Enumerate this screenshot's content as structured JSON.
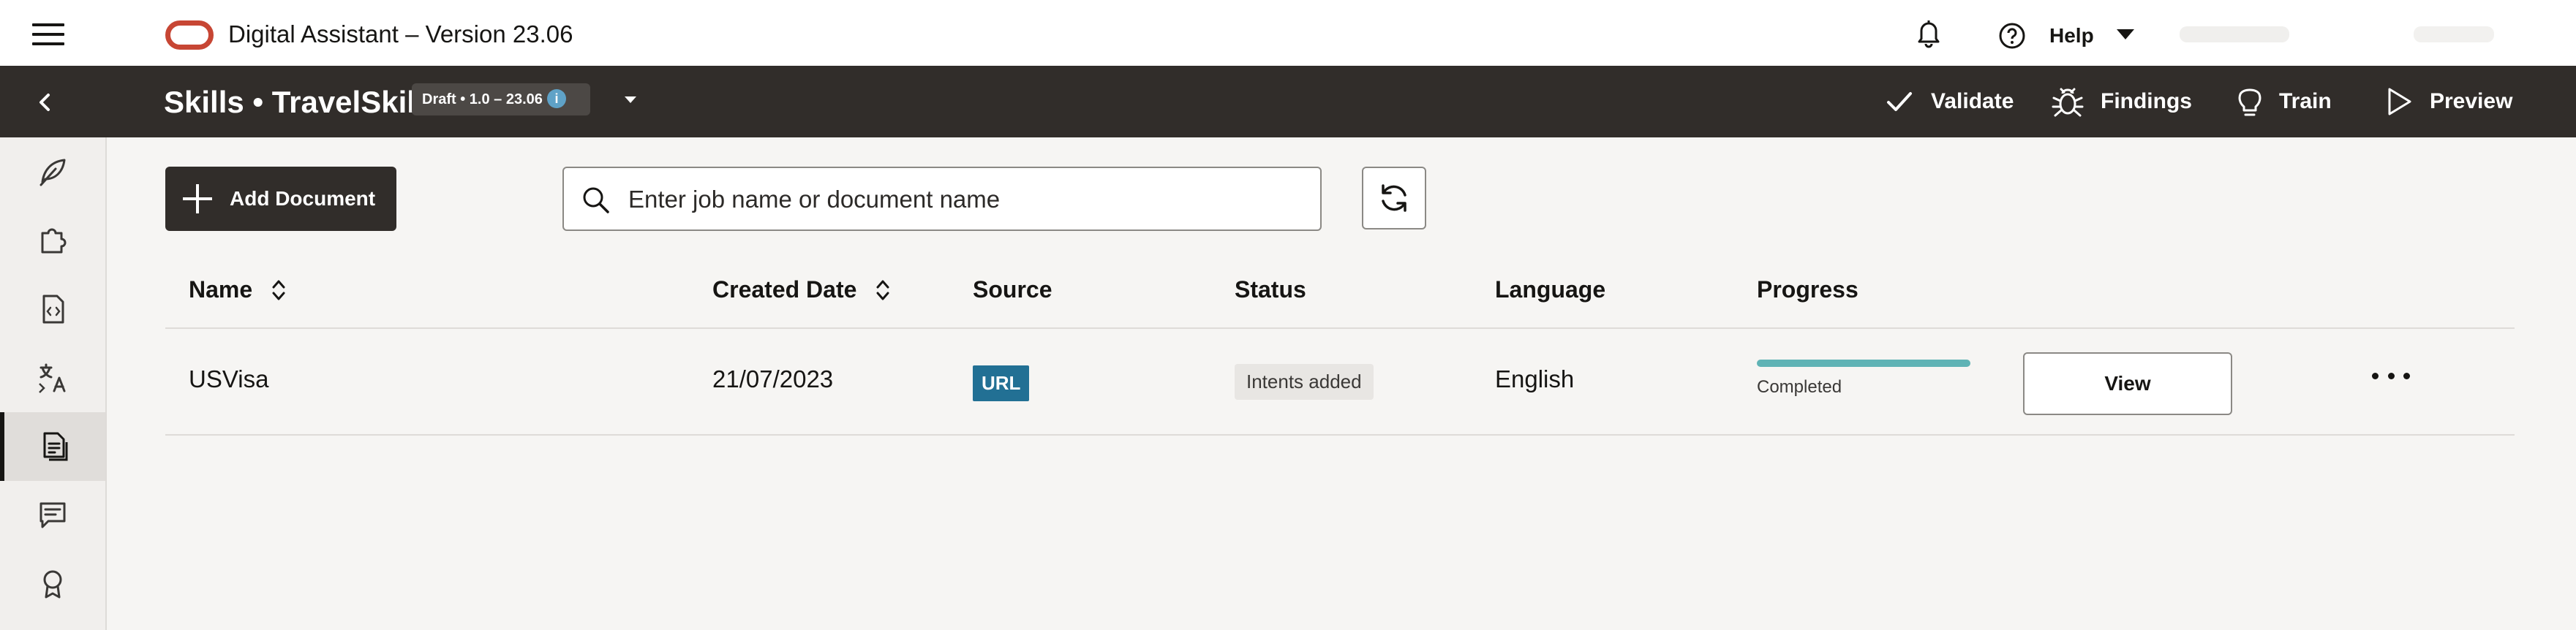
{
  "header": {
    "app_title": "Digital Assistant – Version 23.06",
    "help_label": "Help",
    "icons": {
      "menu": "hamburger-menu-icon",
      "logo": "oracle-logo",
      "notifications": "bell-icon",
      "help": "help-circle-icon"
    }
  },
  "context_bar": {
    "breadcrumb": "Skills • TravelSkill",
    "version_badge": "Draft • 1.0 – 23.06",
    "info_symbol": "i",
    "actions": [
      {
        "label": "Validate",
        "icon": "check-icon"
      },
      {
        "label": "Findings",
        "icon": "bug-icon"
      },
      {
        "label": "Train",
        "icon": "lightbulb-icon"
      },
      {
        "label": "Preview",
        "icon": "play-icon"
      }
    ]
  },
  "sidebar": {
    "items": [
      {
        "icon": "feather-icon"
      },
      {
        "icon": "puzzle-icon"
      },
      {
        "icon": "code-file-icon"
      },
      {
        "icon": "translate-icon"
      },
      {
        "icon": "document-icon",
        "active": true
      },
      {
        "icon": "chat-icon"
      },
      {
        "icon": "award-icon"
      }
    ]
  },
  "toolbar": {
    "add_document_label": "Add Document",
    "search_placeholder": "Enter job name or document name"
  },
  "table": {
    "columns": [
      "Name",
      "Created Date",
      "Source",
      "Status",
      "Language",
      "Progress"
    ],
    "rows": [
      {
        "name": "USVisa",
        "created_date": "21/07/2023",
        "source": "URL",
        "status": "Intents added",
        "language": "English",
        "progress_value": 1.0,
        "progress_label": "Completed",
        "view_label": "View"
      }
    ]
  },
  "colors": {
    "context_bar": "#312d2a",
    "oracle_red": "#c74634",
    "source_badge": "#227094",
    "progress_fill": "#5fb3b5"
  }
}
